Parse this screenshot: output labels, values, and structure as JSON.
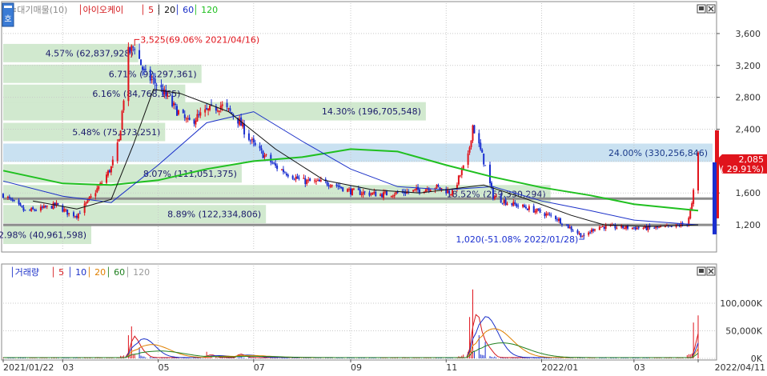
{
  "legend_price": {
    "items": [
      {
        "label": "≡대기매물(10)",
        "color": "#8a8a8a"
      },
      {
        "label": "│아이오케이",
        "color": "#d4181c"
      },
      {
        "label": "│ 5",
        "color": "#d4181c"
      },
      {
        "label": "│ 20",
        "color": "#111111"
      },
      {
        "label": "│ 60",
        "color": "#1a2fc8"
      },
      {
        "label": "│ 120",
        "color": "#20c020"
      }
    ]
  },
  "legend_volume": {
    "items": [
      {
        "label": "│거래량",
        "color": "#1a2fc8"
      },
      {
        "label": "│ 5",
        "color": "#d4181c"
      },
      {
        "label": "│ 10",
        "color": "#1a2fc8"
      },
      {
        "label": "│ 20",
        "color": "#e08000"
      },
      {
        "label": "│ 60",
        "color": "#208020"
      },
      {
        "label": "│ 120",
        "color": "#9a9a9a"
      }
    ]
  },
  "side_tab": "호",
  "colors": {
    "up": "#e0141c",
    "down": "#1a2fd0",
    "ma20": "#111111",
    "ma60": "#1a2fc8",
    "ma120": "#20c020",
    "zone": "#cfe8cc",
    "zone_current": "#c6dff0",
    "ref_line": "#8c8c8c",
    "axis_text": "#333333",
    "grid": "#c9c9c9",
    "current_price_bg": "#e0141c"
  },
  "chart_data": [
    {
      "type": "candlestick",
      "panel": "price",
      "y_axis": {
        "range": [
          880,
          3800
        ],
        "ticks": [
          1200,
          1600,
          2000,
          2400,
          2800,
          3200,
          3600
        ],
        "tick_labels": [
          "1,200",
          "1,600",
          "2,000",
          "2,400",
          "2,800",
          "3,200",
          "3,600"
        ]
      },
      "x_axis": {
        "start": "2021-01-22",
        "end": "2022-04-11",
        "tick_labels": [
          "2021/01/22",
          "03",
          "05",
          "07",
          "09",
          "11",
          "2022/01",
          "03",
          "2022/04/11"
        ]
      },
      "price_path": [
        [
          "2021-01-22",
          1580
        ],
        [
          "2021-02-01",
          1430
        ],
        [
          "2021-02-05",
          1370
        ],
        [
          "2021-02-15",
          1400
        ],
        [
          "2021-02-25",
          1450
        ],
        [
          "2021-03-05",
          1340
        ],
        [
          "2021-03-10",
          1320
        ],
        [
          "2021-03-15",
          1440
        ],
        [
          "2021-03-25",
          1700
        ],
        [
          "2021-04-01",
          1920
        ],
        [
          "2021-04-06",
          2250
        ],
        [
          "2021-04-12",
          3350
        ],
        [
          "2021-04-16",
          3450
        ],
        [
          "2021-04-22",
          3100
        ],
        [
          "2021-05-01",
          2950
        ],
        [
          "2021-05-10",
          2700
        ],
        [
          "2021-05-20",
          2480
        ],
        [
          "2021-06-01",
          2620
        ],
        [
          "2021-06-10",
          2700
        ],
        [
          "2021-06-20",
          2550
        ],
        [
          "2021-07-01",
          2200
        ],
        [
          "2021-07-15",
          1930
        ],
        [
          "2021-08-01",
          1750
        ],
        [
          "2021-08-20",
          1720
        ],
        [
          "2021-09-01",
          1620
        ],
        [
          "2021-09-20",
          1580
        ],
        [
          "2021-10-10",
          1620
        ],
        [
          "2021-10-25",
          1680
        ],
        [
          "2021-11-05",
          1600
        ],
        [
          "2021-11-15",
          2050
        ],
        [
          "2021-11-18",
          2450
        ],
        [
          "2021-11-25",
          2000
        ],
        [
          "2021-12-01",
          1560
        ],
        [
          "2021-12-10",
          1480
        ],
        [
          "2021-12-25",
          1400
        ],
        [
          "2022-01-10",
          1290
        ],
        [
          "2022-01-20",
          1150
        ],
        [
          "2022-01-28",
          1050
        ],
        [
          "2022-02-05",
          1180
        ],
        [
          "2022-02-20",
          1170
        ],
        [
          "2022-03-10",
          1160
        ],
        [
          "2022-03-25",
          1170
        ],
        [
          "2022-04-04",
          1220
        ],
        [
          "2022-04-07",
          1450
        ],
        [
          "2022-04-11",
          2085
        ]
      ],
      "ma20_path": [
        [
          "2021-02-10",
          1500
        ],
        [
          "2021-03-10",
          1400
        ],
        [
          "2021-04-01",
          1520
        ],
        [
          "2021-04-15",
          2200
        ],
        [
          "2021-04-28",
          2900
        ],
        [
          "2021-05-15",
          2850
        ],
        [
          "2021-06-15",
          2620
        ],
        [
          "2021-07-15",
          2150
        ],
        [
          "2021-08-15",
          1760
        ],
        [
          "2021-09-15",
          1640
        ],
        [
          "2021-10-15",
          1600
        ],
        [
          "2021-11-25",
          1700
        ],
        [
          "2021-12-20",
          1540
        ],
        [
          "2022-01-20",
          1320
        ],
        [
          "2022-02-10",
          1200
        ],
        [
          "2022-03-10",
          1180
        ],
        [
          "2022-04-11",
          1200
        ]
      ],
      "ma60_path": [
        [
          "2021-01-22",
          1750
        ],
        [
          "2021-03-01",
          1560
        ],
        [
          "2021-04-01",
          1480
        ],
        [
          "2021-05-01",
          1950
        ],
        [
          "2021-06-01",
          2480
        ],
        [
          "2021-07-01",
          2620
        ],
        [
          "2021-08-01",
          2250
        ],
        [
          "2021-09-01",
          1900
        ],
        [
          "2021-10-01",
          1680
        ],
        [
          "2021-11-01",
          1640
        ],
        [
          "2021-12-01",
          1680
        ],
        [
          "2022-01-01",
          1500
        ],
        [
          "2022-02-01",
          1380
        ],
        [
          "2022-03-01",
          1260
        ],
        [
          "2022-04-11",
          1200
        ]
      ],
      "ma120_path": [
        [
          "2021-01-22",
          1880
        ],
        [
          "2021-03-01",
          1720
        ],
        [
          "2021-04-01",
          1700
        ],
        [
          "2021-05-01",
          1760
        ],
        [
          "2021-06-01",
          1900
        ],
        [
          "2021-07-01",
          2000
        ],
        [
          "2021-08-01",
          2050
        ],
        [
          "2021-09-01",
          2150
        ],
        [
          "2021-10-01",
          2120
        ],
        [
          "2021-11-01",
          1950
        ],
        [
          "2021-12-01",
          1800
        ],
        [
          "2022-01-01",
          1670
        ],
        [
          "2022-02-01",
          1570
        ],
        [
          "2022-03-01",
          1460
        ],
        [
          "2022-04-11",
          1380
        ]
      ],
      "volume_zones": [
        {
          "low": 3240,
          "high": 3470,
          "label": "4.57% (62,837,928)"
        },
        {
          "low": 2980,
          "high": 3210,
          "label": "6.71% (92,297,361)"
        },
        {
          "low": 2730,
          "high": 2960,
          "label": "6.16% (84,768,165)"
        },
        {
          "low": 2510,
          "high": 2740,
          "label": "14.30% (196,705,548)"
        },
        {
          "low": 2250,
          "high": 2480,
          "label": "5.48% (75,373,251)"
        },
        {
          "low": 1990,
          "high": 2220,
          "label": "24.00% (330,256,846)",
          "current": true
        },
        {
          "low": 1730,
          "high": 1960,
          "label": "8.07% (111,051,375)"
        },
        {
          "low": 1470,
          "high": 1700,
          "label": "18.52% (259,330,294)"
        },
        {
          "low": 1220,
          "high": 1450,
          "label": "8.89% (122,334,806)"
        },
        {
          "low": 960,
          "high": 1190,
          "label": "2.98% (40,961,598)"
        }
      ],
      "reference_lines": [
        1530,
        1200
      ],
      "annotations": {
        "high": {
          "text": "3,525(69.06% 2021/04/16)",
          "date": "2021-04-16",
          "value": 3525
        },
        "low": {
          "text": "1,020(-51.08% 2022/01/28)",
          "date": "2022-01-28",
          "value": 1020
        }
      },
      "current_price": {
        "value": 2085,
        "value_label": "2,085",
        "change_label": "( 29.91%)"
      }
    },
    {
      "type": "bar",
      "panel": "volume",
      "y_axis": {
        "range": [
          0,
          145000
        ],
        "ticks": [
          0,
          50000,
          100000
        ],
        "tick_labels": [
          "0K",
          "50,000K",
          "100,000K"
        ]
      },
      "spikes": [
        [
          "2021-04-12",
          42000
        ],
        [
          "2021-04-14",
          58000
        ],
        [
          "2021-04-19",
          20000
        ],
        [
          "2021-06-01",
          12000
        ],
        [
          "2021-06-20",
          15000
        ],
        [
          "2021-11-16",
          75000
        ],
        [
          "2021-11-18",
          125000
        ],
        [
          "2021-11-22",
          42000
        ],
        [
          "2021-11-26",
          30000
        ],
        [
          "2022-04-08",
          65000
        ],
        [
          "2022-04-11",
          78000
        ]
      ]
    }
  ]
}
